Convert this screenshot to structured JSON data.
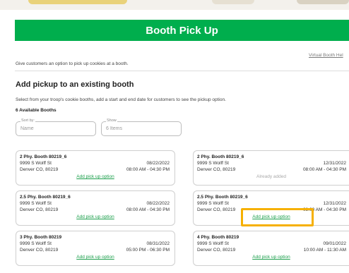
{
  "header": {
    "title": "Booth Pick Up"
  },
  "virtual_link": "Virtual Booth Hel",
  "intro_text": "Give customers an option to pick up cookies at a booth.",
  "section": {
    "title": "Add pickup to an existing booth",
    "description": "Select from your troop's cookie booths, add a start and end date for customers to see the pickup option.",
    "count_label": "6 Available Booths"
  },
  "filters": {
    "sort": {
      "label": "Sort by:",
      "value": "Name"
    },
    "show": {
      "label": "Show",
      "value": "6 Items"
    }
  },
  "booths": [
    {
      "name": "2 Phy. Booth 80219_6",
      "address": "9999 S Wolff St",
      "city": "Denver CO, 80219",
      "date": "08/22/2022",
      "time": "08:00 AM - 04:30 PM",
      "action": "Add pick up option"
    },
    {
      "name": "2 Phy. Booth 80219_6",
      "address": "9999 S Wolff St",
      "city": "Denver CO, 80219",
      "date": "12/31/2022",
      "time": "08:00 AM - 04:30 PM",
      "action": "Already added"
    },
    {
      "name": "2.5 Phy. Booth 80219_6",
      "address": "9999 S Wolff St",
      "city": "Denver CO, 80219",
      "date": "08/22/2022",
      "time": "08:00 AM - 04:30 PM",
      "action": "Add pick up option"
    },
    {
      "name": "2.5 Phy. Booth 80219_6",
      "address": "9999 S Wolff St",
      "city": "Denver CO, 80219",
      "date": "12/31/2022",
      "time": "08:00 AM - 04:30 PM",
      "action": "Add pick up option"
    },
    {
      "name": "3 Phy. Booth 80219",
      "address": "9999 S Wolff St",
      "city": "Denver CO, 80219",
      "date": "08/31/2022",
      "time": "05:00 PM - 06:30 PM",
      "action": "Add pick up option"
    },
    {
      "name": "4 Phy. Booth 80219",
      "address": "9999 S Wolff St",
      "city": "Denver CO, 80219",
      "date": "09/01/2022",
      "time": "10:00 AM - 11:30 AM",
      "action": "Add pick up option"
    }
  ],
  "colors": {
    "brand": "#00ae4d",
    "link": "#1b9f4b",
    "highlight": "#f6b000"
  }
}
